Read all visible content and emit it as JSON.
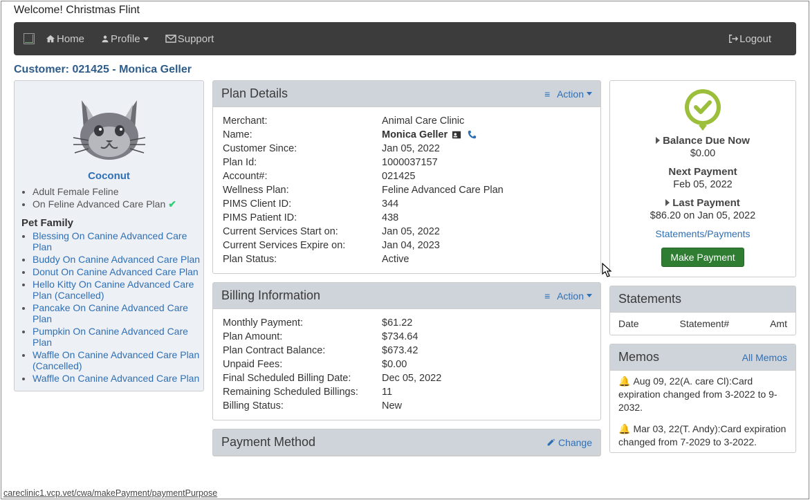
{
  "welcome": "Welcome! Christmas Flint",
  "nav": {
    "home": "Home",
    "profile": "Profile",
    "support": "Support",
    "logout": "Logout"
  },
  "customer_heading": "Customer: 021425 - Monica Geller",
  "pet": {
    "name": "Coconut",
    "attr1": "Adult Female Feline",
    "plan_line": "On Feline Advanced Care Plan"
  },
  "pet_family_heading": "Pet Family",
  "pet_family": [
    "Blessing On Canine Advanced Care Plan",
    "Buddy On Canine Advanced Care Plan",
    "Donut On Canine Advanced Care Plan",
    "Hello Kitty On Canine Advanced Care Plan (Cancelled)",
    "Pancake On Canine Advanced Care Plan",
    "Pumpkin On Canine Advanced Care Plan",
    "Waffle On Canine Advanced Care Plan (Cancelled)",
    "Waffle On Canine Advanced Care Plan"
  ],
  "panels": {
    "plan_title": "Plan Details",
    "billing_title": "Billing Information",
    "payment_title": "Payment Method",
    "action": "Action",
    "change": "Change"
  },
  "plan": {
    "merchant": {
      "k": "Merchant:",
      "v": "Animal Care Clinic"
    },
    "name": {
      "k": "Name:",
      "v": "Monica Geller"
    },
    "since": {
      "k": "Customer Since:",
      "v": "Jan 05, 2022"
    },
    "planid": {
      "k": "Plan Id:",
      "v": "1000037157"
    },
    "account": {
      "k": "Account#:",
      "v": "021425"
    },
    "wellness": {
      "k": "Wellness Plan:",
      "v": "Feline Advanced Care Plan"
    },
    "pims_client": {
      "k": "PIMS Client ID:",
      "v": "344"
    },
    "pims_patient": {
      "k": "PIMS Patient ID:",
      "v": "438"
    },
    "svc_start": {
      "k": "Current Services Start on:",
      "v": "Jan 05, 2022"
    },
    "svc_end": {
      "k": "Current Services Expire on:",
      "v": "Jan 04, 2023"
    },
    "status": {
      "k": "Plan Status:",
      "v": "Active"
    }
  },
  "billing": {
    "monthly": {
      "k": "Monthly Payment:",
      "v": "$61.22"
    },
    "plan_amt": {
      "k": "Plan Amount:",
      "v": "$734.64"
    },
    "contract_bal": {
      "k": "Plan Contract Balance:",
      "v": "$673.42"
    },
    "unpaid": {
      "k": "Unpaid Fees:",
      "v": "$0.00"
    },
    "final_date": {
      "k": "Final Scheduled Billing Date:",
      "v": "Dec 05, 2022"
    },
    "remaining": {
      "k": "Remaining Scheduled Billings:",
      "v": "11"
    },
    "bstatus": {
      "k": "Billing Status:",
      "v": "New"
    }
  },
  "summary": {
    "balance_label": "Balance Due Now",
    "balance_val": "$0.00",
    "next_label": "Next Payment",
    "next_val": "Feb 05, 2022",
    "last_label": "Last Payment",
    "last_val": "$86.20 on Jan 05, 2022",
    "stmts_link": "Statements/Payments",
    "make_payment": "Make Payment"
  },
  "statements": {
    "title": "Statements",
    "col_date": "Date",
    "col_num": "Statement#",
    "col_amt": "Amt"
  },
  "memos": {
    "title": "Memos",
    "all": "All Memos",
    "items": [
      "Aug 09, 22(A. care Cl):Card expiration changed from 3-2022 to 9-2032.",
      "Mar 03, 22(T. Andy):Card expiration changed from 7-2029 to 3-2022."
    ]
  },
  "status_url": "careclinic1.vcp.vet/cwa/makePayment/paymentPurpose"
}
